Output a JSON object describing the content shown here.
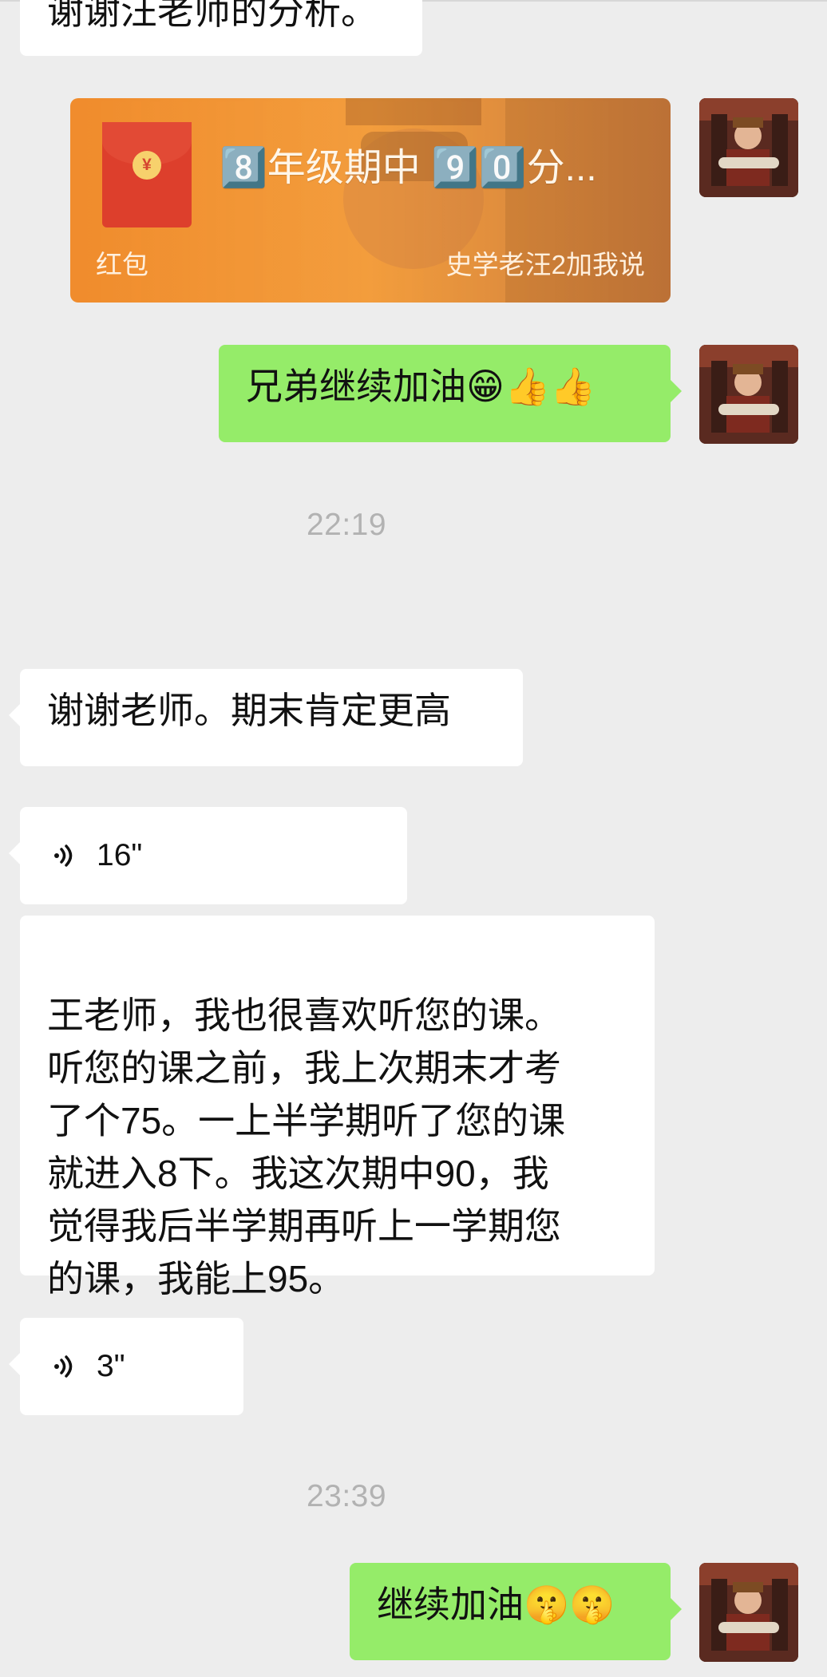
{
  "partial_top_message": "谢谢汪老师的分析。",
  "red_packet": {
    "title": "8️⃣年级期中 9️⃣0️⃣分...",
    "label": "红包",
    "note": "史学老汪2加我说"
  },
  "messages": [
    {
      "text": "兄弟继续加油😁👍👍"
    },
    {
      "text": "22:19"
    },
    {
      "text": "谢谢老师。期末肯定更高"
    },
    {
      "text": "16\""
    },
    {
      "text": "王老师，我也很喜欢听您的课。\n听您的课之前，我上次期末才考\n了个75。一上半学期听了您的课\n就进入8下。我这次期中90，我\n觉得我后半学期再听上一学期您\n的课，我能上95。"
    },
    {
      "text": "3\""
    },
    {
      "text": "23:39"
    },
    {
      "text": "继续加油🤫🤫"
    }
  ],
  "colors": {
    "background": "#ededed",
    "incoming_bubble": "#ffffff",
    "outgoing_bubble": "#95ec69",
    "timestamp": "#b2b2b2",
    "red_packet": "#f29a2e"
  },
  "icons": {
    "voice": "voice-wave-icon",
    "packet": "red-packet-icon"
  }
}
